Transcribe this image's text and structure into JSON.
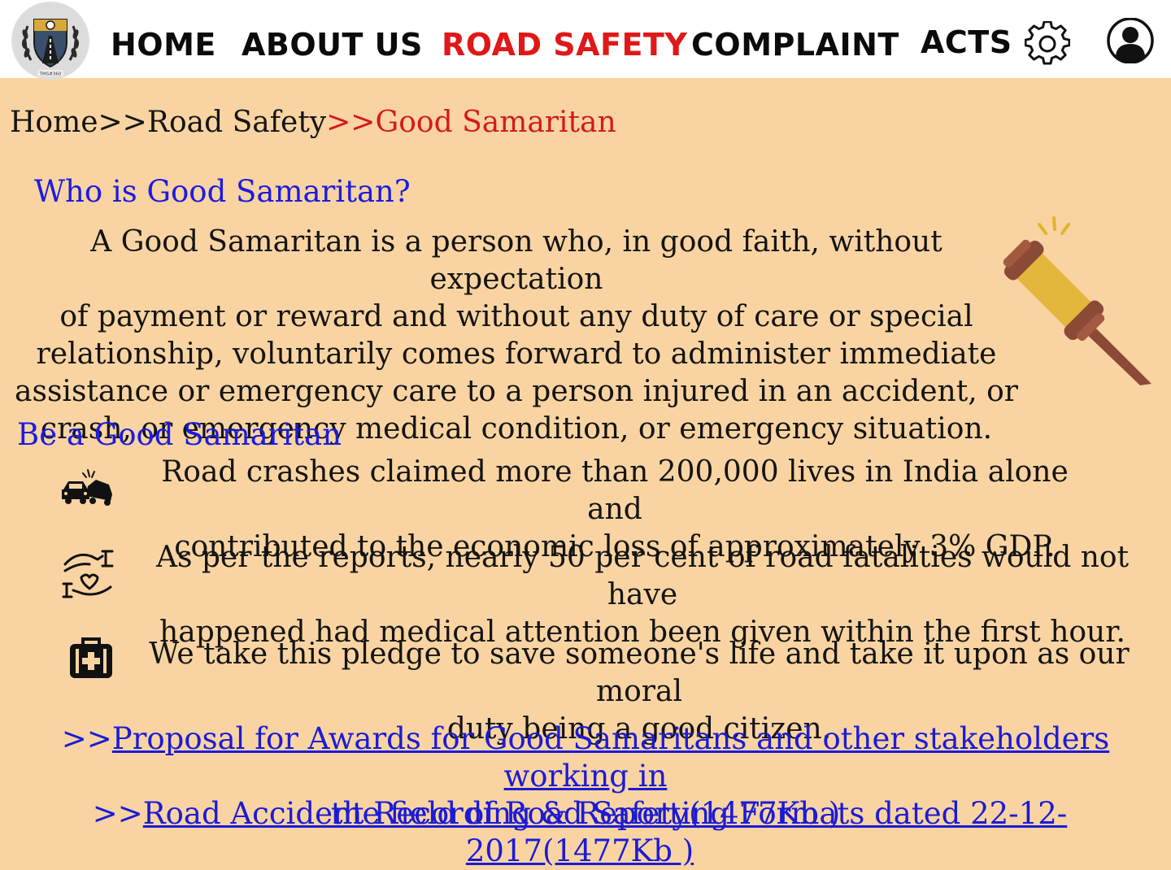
{
  "nav": {
    "logo_text": "TMS#360",
    "items": [
      "HOME",
      "ABOUT US",
      "ROAD SAFETY",
      "COMPLAINT",
      "ACTS"
    ],
    "active": "ROAD SAFETY",
    "settings_icon": "gear-icon",
    "profile_icon": "user-icon"
  },
  "breadcrumb": {
    "home": "Home",
    "sep1": ">>",
    "road_safety": "Road Safety",
    "sep2": ">>",
    "current": "Good Samaritan"
  },
  "who": {
    "heading": "Who is Good Samaritan?",
    "lines": [
      "A Good Samaritan is a person who, in good faith, without expectation",
      "of payment or reward and without any duty of care or special",
      "relationship, voluntarily comes forward to administer immediate",
      "assistance or emergency care to a person injured in an accident, or",
      "crash, or emergency medical condition, or emergency situation."
    ],
    "illustration_icon": "gavel-icon"
  },
  "be": {
    "heading": "Be a Good Samaritan",
    "points": [
      {
        "icon": "car-crash-icon",
        "lines": [
          "Road crashes claimed more than 200,000 lives in India alone and",
          "contributed to the economic loss of approximately 3% GDP."
        ]
      },
      {
        "icon": "helping-hands-icon",
        "lines": [
          "As per the reports, nearly 50 per cent of road fatalities would not have",
          "happened had medical attention been given within the first hour."
        ]
      },
      {
        "icon": "first-aid-kit-icon",
        "lines": [
          "We take this pledge to save someone's life and take it upon as our moral",
          "duty being a good citizen."
        ]
      }
    ]
  },
  "links": [
    {
      "prefix": ">>",
      "line1": "Proposal for Awards for Good Samaritans and other stakeholders working in",
      "line2": "the field of Road Safety(1477Kb )"
    },
    {
      "prefix": ">>",
      "line1": "Road Accident Recording & Reporting Formats dated 22-12-2017(1477Kb )"
    }
  ],
  "colors": {
    "background": "#f9d4a2",
    "active_nav": "#e01818",
    "heading_blue": "#1c1ce0",
    "link_blue": "#1b1bd6",
    "breadcrumb_red": "#d41a1a"
  }
}
